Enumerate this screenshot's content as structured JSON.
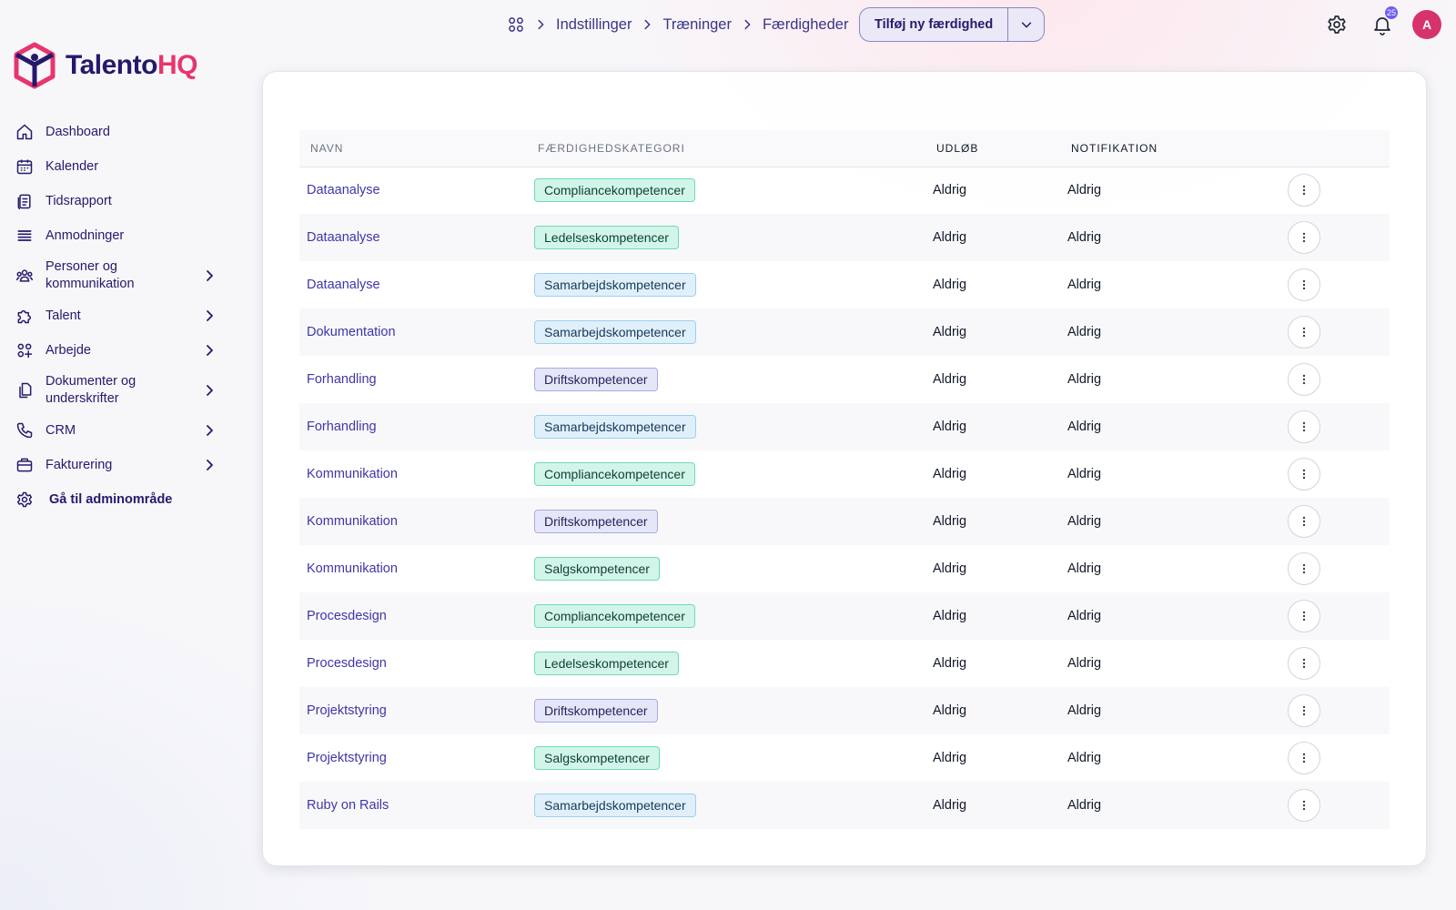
{
  "brand": {
    "part1": "Talento",
    "part2": "HQ",
    "accent": "#e8356d",
    "primary": "#241a6b"
  },
  "sidebar": {
    "items": [
      {
        "label": "Dashboard",
        "icon": "home-icon",
        "expandable": false
      },
      {
        "label": "Kalender",
        "icon": "calendar-icon",
        "expandable": false
      },
      {
        "label": "Tidsrapport",
        "icon": "clipboard-icon",
        "expandable": false
      },
      {
        "label": "Anmodninger",
        "icon": "list-icon",
        "expandable": false
      },
      {
        "label": "Personer og kommunikation",
        "icon": "people-icon",
        "expandable": true
      },
      {
        "label": "Talent",
        "icon": "puzzle-icon",
        "expandable": true
      },
      {
        "label": "Arbejde",
        "icon": "grid-icon",
        "expandable": true
      },
      {
        "label": "Dokumenter og underskrifter",
        "icon": "documents-icon",
        "expandable": true
      },
      {
        "label": "CRM",
        "icon": "phone-icon",
        "expandable": true
      },
      {
        "label": "Fakturering",
        "icon": "briefcase-icon",
        "expandable": true
      },
      {
        "label": "Gå til adminområde",
        "icon": "gear-icon",
        "expandable": false
      }
    ]
  },
  "breadcrumb": {
    "items": [
      "Indstillinger",
      "Træninger",
      "Færdigheder"
    ]
  },
  "actions": {
    "add_label": "Tilføj ny færdighed"
  },
  "header": {
    "notification_count": "25",
    "avatar_initial": "A"
  },
  "table": {
    "columns": [
      "NAVN",
      "FÆRDIGHEDSKATEGORI",
      "UDLØB",
      "NOTIFIKATION"
    ],
    "rows": [
      {
        "name": "Dataanalyse",
        "category": "Compliancekompetencer",
        "expiry": "Aldrig",
        "notification": "Aldrig"
      },
      {
        "name": "Dataanalyse",
        "category": "Ledelseskompetencer",
        "expiry": "Aldrig",
        "notification": "Aldrig"
      },
      {
        "name": "Dataanalyse",
        "category": "Samarbejdskompetencer",
        "expiry": "Aldrig",
        "notification": "Aldrig"
      },
      {
        "name": "Dokumentation",
        "category": "Samarbejdskompetencer",
        "expiry": "Aldrig",
        "notification": "Aldrig"
      },
      {
        "name": "Forhandling",
        "category": "Driftskompetencer",
        "expiry": "Aldrig",
        "notification": "Aldrig"
      },
      {
        "name": "Forhandling",
        "category": "Samarbejdskompetencer",
        "expiry": "Aldrig",
        "notification": "Aldrig"
      },
      {
        "name": "Kommunikation",
        "category": "Compliancekompetencer",
        "expiry": "Aldrig",
        "notification": "Aldrig"
      },
      {
        "name": "Kommunikation",
        "category": "Driftskompetencer",
        "expiry": "Aldrig",
        "notification": "Aldrig"
      },
      {
        "name": "Kommunikation",
        "category": "Salgskompetencer",
        "expiry": "Aldrig",
        "notification": "Aldrig"
      },
      {
        "name": "Procesdesign",
        "category": "Compliancekompetencer",
        "expiry": "Aldrig",
        "notification": "Aldrig"
      },
      {
        "name": "Procesdesign",
        "category": "Ledelseskompetencer",
        "expiry": "Aldrig",
        "notification": "Aldrig"
      },
      {
        "name": "Projektstyring",
        "category": "Driftskompetencer",
        "expiry": "Aldrig",
        "notification": "Aldrig"
      },
      {
        "name": "Projektstyring",
        "category": "Salgskompetencer",
        "expiry": "Aldrig",
        "notification": "Aldrig"
      },
      {
        "name": "Ruby on Rails",
        "category": "Samarbejdskompetencer",
        "expiry": "Aldrig",
        "notification": "Aldrig"
      }
    ]
  }
}
